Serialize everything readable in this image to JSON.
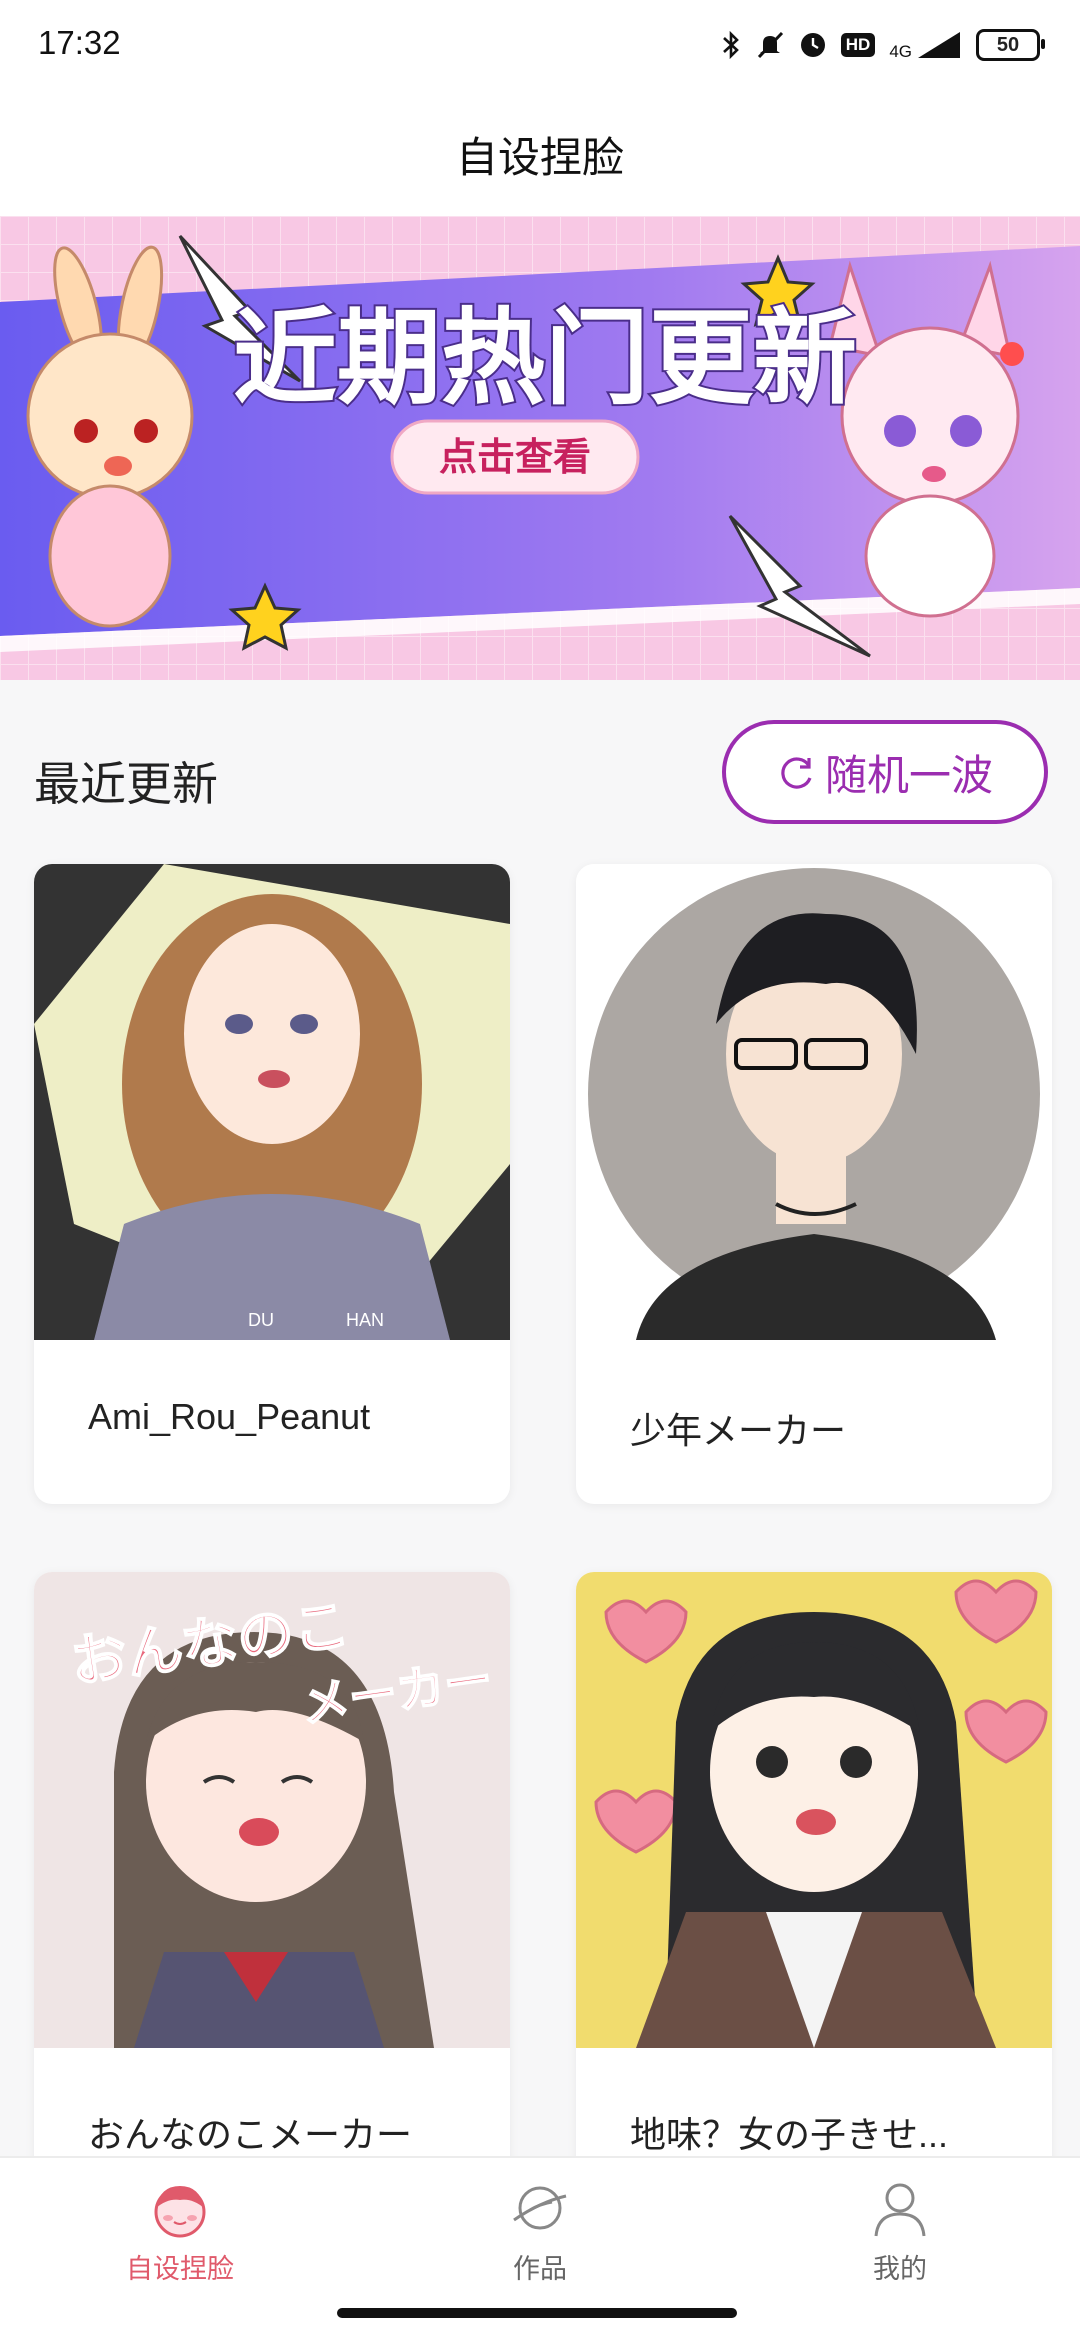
{
  "status_bar": {
    "time": "17:32",
    "network": "4G",
    "hd": "HD",
    "battery": "50",
    "icons": [
      "bluetooth-icon",
      "mute-icon",
      "alarm-icon",
      "hd-icon",
      "signal-icon",
      "battery-icon"
    ]
  },
  "header": {
    "title": "自设捏脸"
  },
  "banner": {
    "headline": "近期热门更新",
    "button_label": "点击查看"
  },
  "section": {
    "title": "最近更新",
    "random_label": "随机一波",
    "random_icon": "refresh-icon"
  },
  "cards": [
    {
      "title": "Ami_Rou_Peanut",
      "thumb_text": [
        "DU",
        "HAN"
      ]
    },
    {
      "title": "少年メーカー"
    },
    {
      "title": "おんなのこメーカー",
      "thumb_text": [
        "おんなのこ",
        "メーカー"
      ]
    },
    {
      "title": "地味？女の子きせ..."
    }
  ],
  "bottom_nav": {
    "items": [
      {
        "label": "自设捏脸",
        "icon": "face-icon",
        "active": true
      },
      {
        "label": "作品",
        "icon": "planet-icon",
        "active": false
      },
      {
        "label": "我的",
        "icon": "person-icon",
        "active": false
      }
    ]
  },
  "colors": {
    "accent": "#9b2db0",
    "nav_active": "#e05a6b",
    "banner_stripe": "#8d6cf2"
  }
}
